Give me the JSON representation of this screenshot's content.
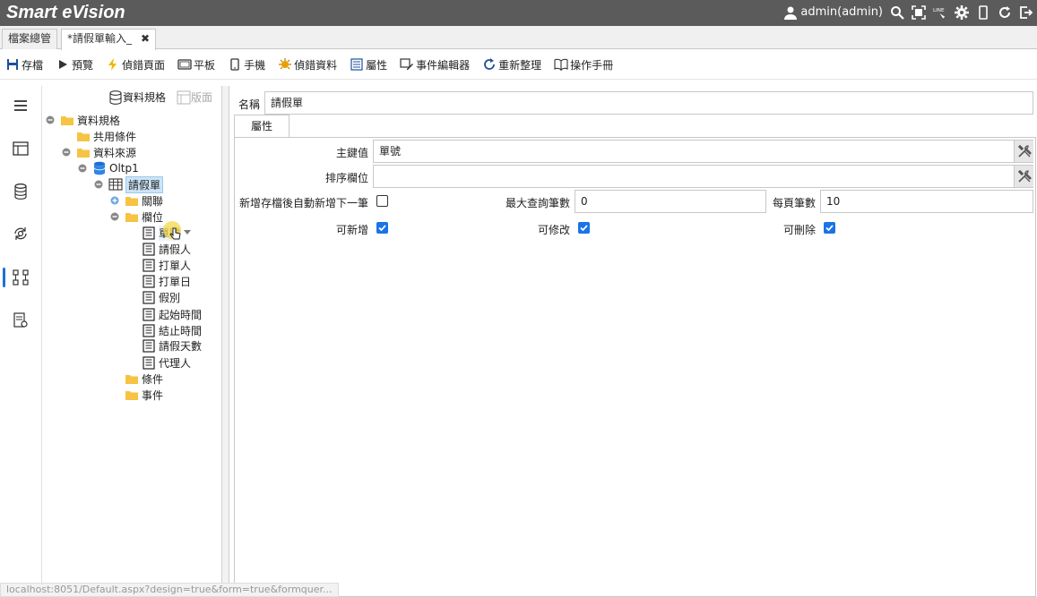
{
  "app": {
    "title": "Smart eVision",
    "user": "admin(admin)"
  },
  "tabs": [
    {
      "label": "檔案總管"
    },
    {
      "label": "*請假單輸入_",
      "close": "✖"
    }
  ],
  "toolbar": {
    "save": "存檔",
    "preview": "預覽",
    "debug_page": "偵錯頁面",
    "tablet": "平板",
    "phone": "手機",
    "debug_data": "偵錯資料",
    "properties": "屬性",
    "event_editor": "事件編輯器",
    "refresh": "重新整理",
    "manual": "操作手冊"
  },
  "tree": {
    "header_spec": "資料規格",
    "header_layout": "版面",
    "nodes": {
      "root": "資料規格",
      "common": "共用條件",
      "datasource": "資料來源",
      "oltp": "Oltp1",
      "table": "請假單",
      "relation": "關聯",
      "fields": "欄位",
      "f1": "單號",
      "f2": "請假人",
      "f3": "打單人",
      "f4": "打單日",
      "f5": "假別",
      "f6": "起始時間",
      "f7": "結止時間",
      "f8": "請假天數",
      "f9": "代理人",
      "conditions": "條件",
      "events": "事件"
    }
  },
  "form": {
    "name_label": "名稱",
    "name_value": "請假單",
    "props_tab": "屬性",
    "pk_label": "主鍵值",
    "pk_value": "單號",
    "sort_label": "排序欄位",
    "sort_value": "",
    "auto_add_label": "新增存檔後自動新增下一筆",
    "auto_add_checked": false,
    "max_query_label": "最大查詢筆數",
    "max_query_value": "0",
    "page_size_label": "每頁筆數",
    "page_size_value": "10",
    "can_add_label": "可新增",
    "can_add_checked": true,
    "can_edit_label": "可修改",
    "can_edit_checked": true,
    "can_delete_label": "可刪除",
    "can_delete_checked": true
  },
  "status": {
    "url": "localhost:8051/Default.aspx?design=true&form=true&formquer..."
  },
  "colors": {
    "topbar": "#5b5b5b",
    "accent": "#1a73e8",
    "selection": "#cce4f7"
  }
}
